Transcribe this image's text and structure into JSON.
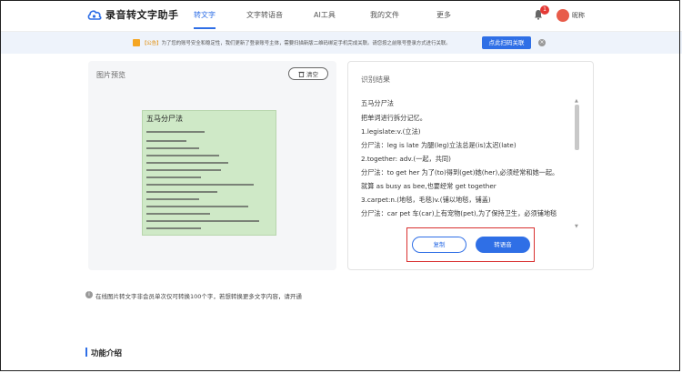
{
  "header": {
    "app_name": "录音转文字助手",
    "nav": [
      {
        "label": "转文字",
        "active": true
      },
      {
        "label": "文字转语音",
        "active": false
      },
      {
        "label": "AI工具",
        "active": false
      },
      {
        "label": "我的文件",
        "active": false
      },
      {
        "label": "更多",
        "active": false
      }
    ],
    "notification_count": "1",
    "username": "昵称",
    "accent_color": "#2f6fe6"
  },
  "notice": {
    "tag": "【公告】",
    "text": "为了您的账号安全和稳定性，我们更新了登录账号主体，需要扫描新版二维码绑定手机完成关联。请您按之前账号登录方式进行关联。",
    "button_label": "点此扫码关联",
    "close_icon": "close-icon"
  },
  "left_panel": {
    "title": "图片预览",
    "clear_label": "清空",
    "doc_title": "五马分尸法"
  },
  "right_panel": {
    "title": "识别结果",
    "lines": [
      "五马分尸法",
      "把单词进行拆分记忆。",
      "1.legislate:v.(立法)",
      "分尸法：leg is late 为腿(leg)立法总是(is)太迟(late)",
      "2.together: adv.(一起，共同)",
      "分尸法：to get her 为了(to)得到(get)她(her),必须经常和她一起。",
      "就算 as busy as bee,也要经常 get together",
      "3.carpet:n.(地毯，毛毯)v.(铺以地毯，铺盖)",
      "分尸法：car pet 车(car)上有宠物(pet),为了保持卫生，必须铺地毯"
    ],
    "copy_label": "复制",
    "voice_label": "转语音"
  },
  "tip": "在线图片转文字非会员单次仅可转换100个字，若想转换更多文字内容，请开通",
  "intro_heading": "功能介绍"
}
